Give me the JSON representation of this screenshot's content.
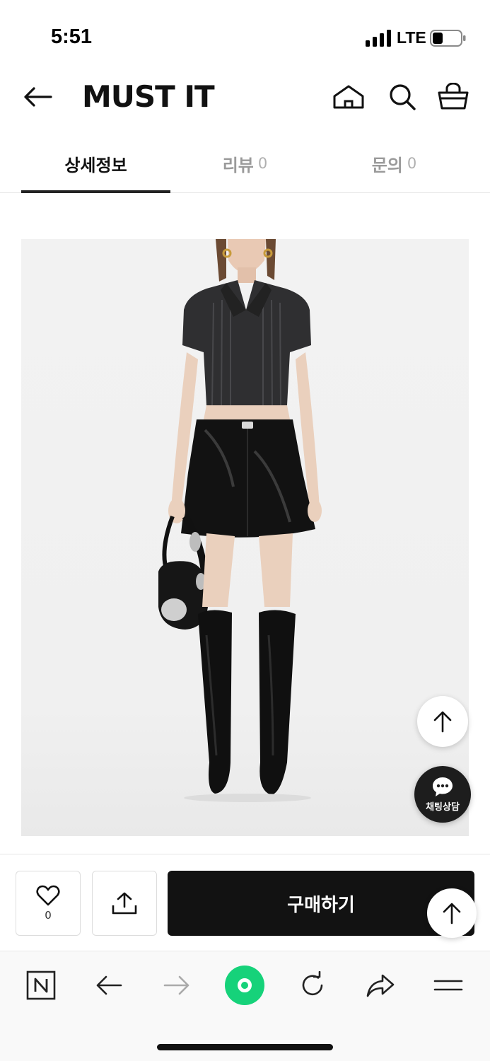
{
  "status_bar": {
    "time": "5:51",
    "network": "LTE"
  },
  "header": {
    "logo": "MUST IT",
    "icons": [
      "back-arrow-icon",
      "home-icon",
      "search-icon",
      "shopping-basket-icon"
    ]
  },
  "tabs": [
    {
      "label": "상세정보",
      "count": "",
      "active": true
    },
    {
      "label": "리뷰",
      "count": "0",
      "active": false
    },
    {
      "label": "문의",
      "count": "0",
      "active": false
    }
  ],
  "floating": {
    "chat_label": "채팅상담"
  },
  "purchase_bar": {
    "like_count": "0",
    "buy_label": "구매하기"
  },
  "colors": {
    "accent_dark": "#121212",
    "browser_green": "#16d27a",
    "inactive_tab": "#9a9a9a"
  }
}
